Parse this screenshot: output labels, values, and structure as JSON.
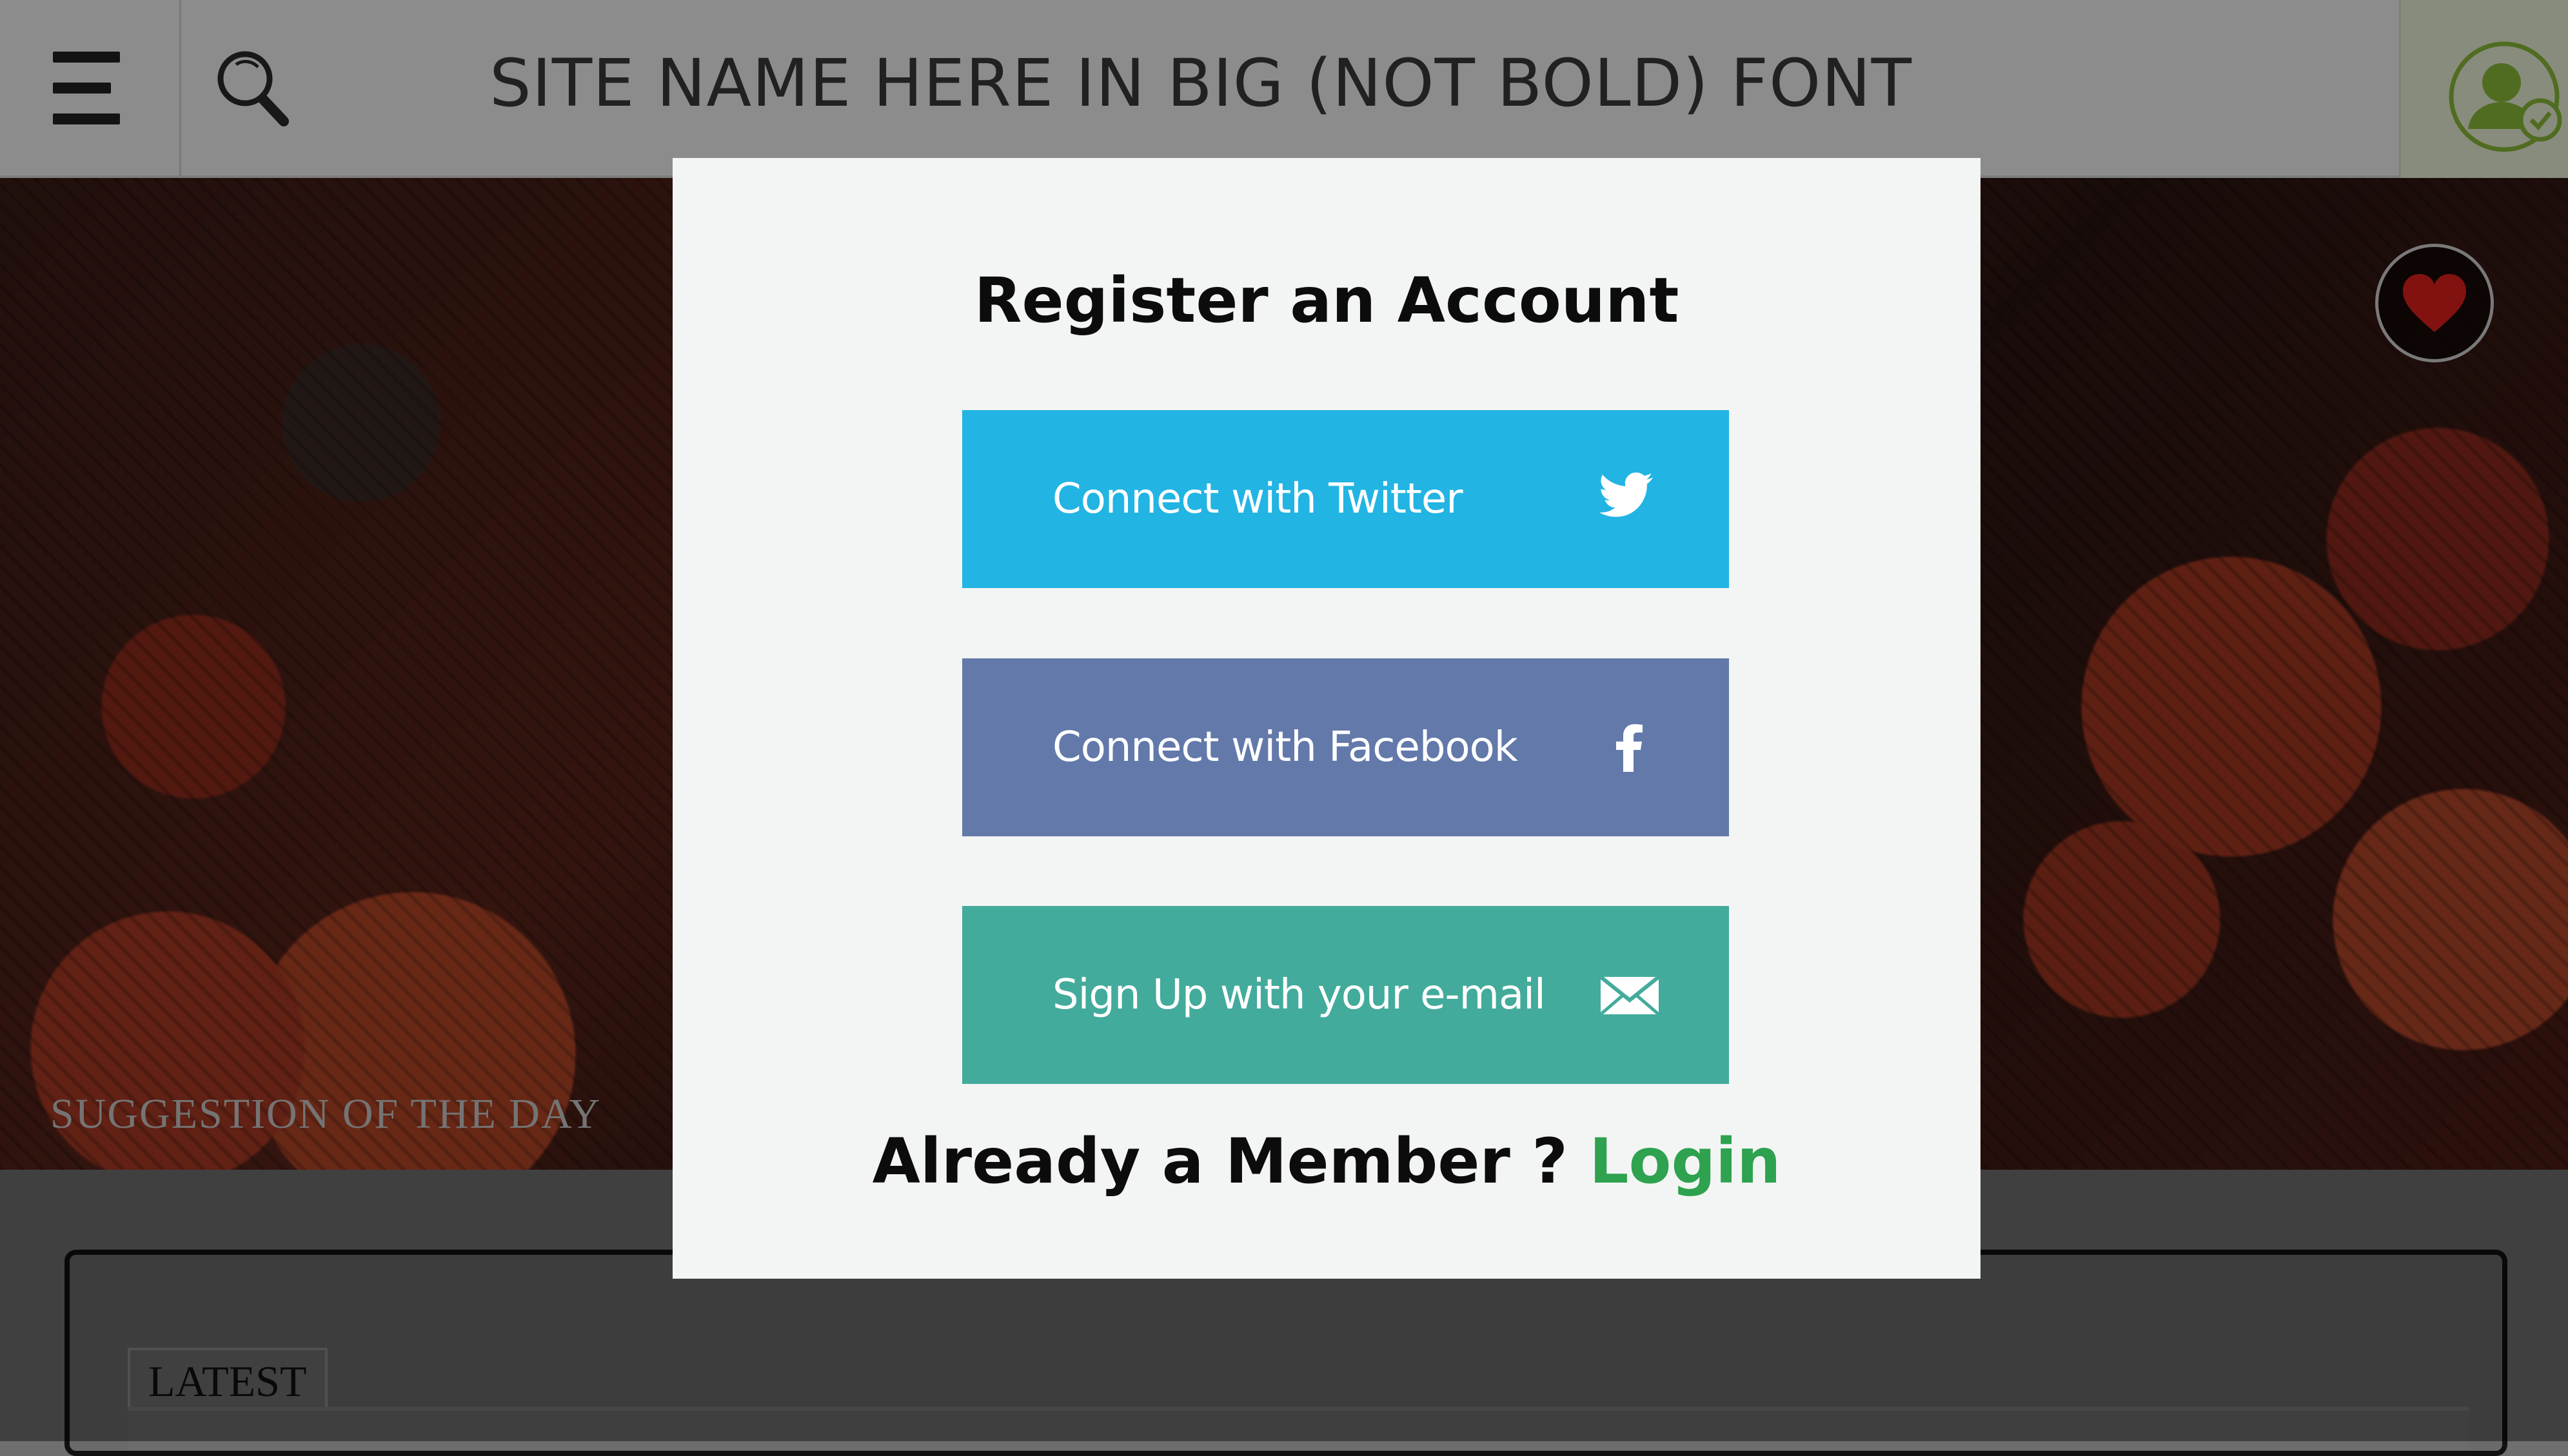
{
  "header": {
    "site_title": "SITE NAME HERE IN BIG (NOT BOLD) FONT",
    "menu_icon": "hamburger-menu-icon",
    "search_icon": "search-icon",
    "account_icon": "user-verified-icon"
  },
  "hero": {
    "caption": "SUGGESTION OF THE DAY",
    "favorite_icon": "heart-icon"
  },
  "content": {
    "tab_label": "LATEST"
  },
  "modal": {
    "title": "Register an Account",
    "buttons": [
      {
        "label": "Connect with Twitter",
        "icon": "twitter-icon",
        "color": "#22b4e3"
      },
      {
        "label": "Connect with Facebook",
        "icon": "facebook-icon",
        "color": "#6279aa"
      },
      {
        "label": "Sign Up with your e-mail",
        "icon": "envelope-icon",
        "color": "#43ab9b"
      }
    ],
    "member_prompt": "Already a Member ? ",
    "login_label": "Login"
  },
  "colors": {
    "login_link": "#2ea24f",
    "account_badge": "#8bbb3a"
  }
}
